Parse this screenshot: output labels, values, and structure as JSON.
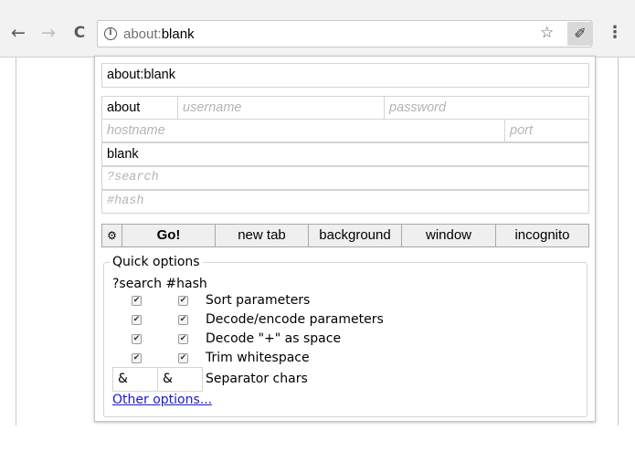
{
  "browser": {
    "back_glyph": "←",
    "forward_glyph": "→",
    "reload_glyph": "C",
    "url_scheme": "about:",
    "url_host": "blank",
    "info_glyph": "i",
    "star_glyph": "☆",
    "extension_glyph": "✐",
    "menu_glyph": "⋮"
  },
  "popup": {
    "full_url": "about:blank",
    "scheme": "about",
    "username_placeholder": "username",
    "password_placeholder": "password",
    "hostname_placeholder": "hostname",
    "port_placeholder": "port",
    "path": "blank",
    "search_placeholder": "?search",
    "hash_placeholder": "#hash",
    "buttons": {
      "settings_glyph": "⚙",
      "go": "Go!",
      "new_tab": "new tab",
      "background": "background",
      "window": "window",
      "incognito": "incognito"
    },
    "quick_options": {
      "legend": "Quick options",
      "column_header": "?search #hash",
      "check_glyph": "✔",
      "options": [
        {
          "label": "Sort parameters",
          "search": true,
          "hash": true
        },
        {
          "label": "Decode/encode parameters",
          "search": true,
          "hash": true
        },
        {
          "label": "Decode \"+\" as space",
          "search": true,
          "hash": true
        },
        {
          "label": "Trim whitespace",
          "search": true,
          "hash": true
        }
      ],
      "separator_search": "&",
      "separator_hash": "&",
      "separator_label": "Separator chars",
      "other_options": "Other options..."
    }
  },
  "colors": {
    "toolbar_bg": "#f2f2f2",
    "button_bg": "#efefef",
    "link": "#1a1ad6"
  }
}
